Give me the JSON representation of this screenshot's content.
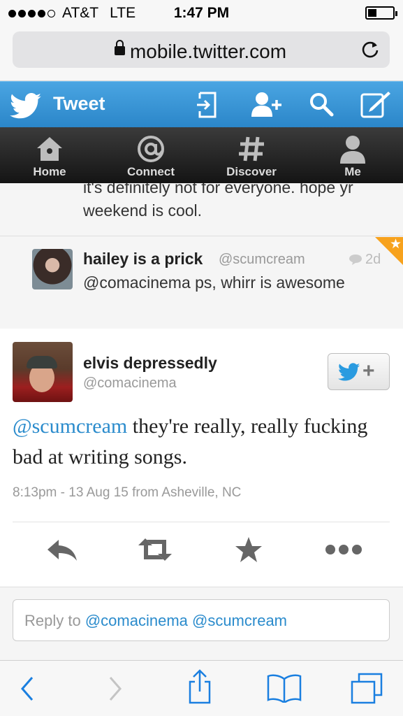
{
  "status_bar": {
    "carrier": "AT&T",
    "network": "LTE",
    "time": "1:47 PM",
    "signal_bars": 4,
    "signal_max": 5,
    "battery_level": 0.3
  },
  "browser": {
    "url": "mobile.twitter.com",
    "secure": true
  },
  "twitter_header": {
    "title": "Tweet",
    "icons": [
      "sign-out-icon",
      "add-user-icon",
      "search-icon",
      "compose-icon"
    ]
  },
  "nav": {
    "items": [
      {
        "label": "Home",
        "icon": "home-icon"
      },
      {
        "label": "Connect",
        "icon": "at-icon"
      },
      {
        "label": "Discover",
        "icon": "hash-icon"
      },
      {
        "label": "Me",
        "icon": "person-icon"
      }
    ]
  },
  "previous_tweet": {
    "text": "it's definitely not for everyone. hope yr weekend is cool."
  },
  "reply_tweet": {
    "name": "hailey is a prick",
    "handle": "@scumcream",
    "time": "2d",
    "text": "@comacinema ps, whirr is awesome",
    "favorited": true
  },
  "main_tweet": {
    "name": "elvis depressedly",
    "handle": "@comacinema",
    "mention": "@scumcream",
    "text": " they're really, really fucking bad at writing songs.",
    "meta": "8:13pm - 13 Aug 15 from Asheville, NC",
    "actions": [
      "reply-icon",
      "retweet-icon",
      "favorite-icon",
      "more-icon"
    ]
  },
  "reply_box": {
    "prefix": "Reply to ",
    "mentions": "@comacinema @scumcream"
  },
  "colors": {
    "twitter_blue": "#2a8bcc",
    "header_gradient_top": "#4aa5e2",
    "header_gradient_bottom": "#2b86c9",
    "safari_blue": "#1a7fe0",
    "favorite_orange": "#f7a21d"
  }
}
